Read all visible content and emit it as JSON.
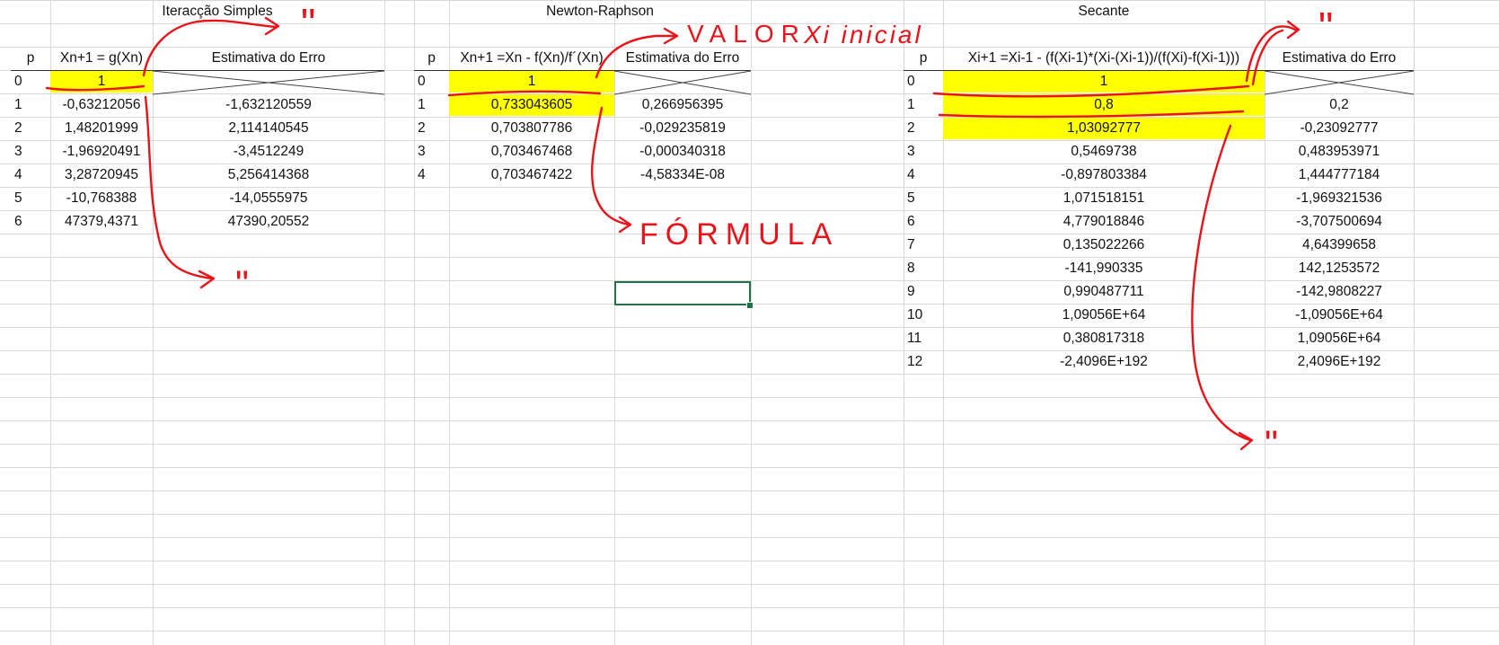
{
  "sections": {
    "iteracao": {
      "title": "Iteracção Simples",
      "headers": {
        "p": "p",
        "x": "Xn+1 = g(Xn)",
        "err": "Estimativa do Erro"
      },
      "rows": [
        {
          "p": "0",
          "x": "1",
          "err": ""
        },
        {
          "p": "1",
          "x": "-0,63212056",
          "err": "-1,632120559"
        },
        {
          "p": "2",
          "x": "1,48201999",
          "err": "2,114140545"
        },
        {
          "p": "3",
          "x": "-1,96920491",
          "err": "-3,4512249"
        },
        {
          "p": "4",
          "x": "3,28720945",
          "err": "5,256414368"
        },
        {
          "p": "5",
          "x": "-10,768388",
          "err": "-14,0555975"
        },
        {
          "p": "6",
          "x": "47379,4371",
          "err": "47390,20552"
        }
      ]
    },
    "newton": {
      "title": "Newton-Raphson",
      "headers": {
        "p": "p",
        "x": "Xn+1 =Xn - f(Xn)/f´(Xn)",
        "err": "Estimativa do Erro"
      },
      "rows": [
        {
          "p": "0",
          "x": "1",
          "err": ""
        },
        {
          "p": "1",
          "x": "0,733043605",
          "err": "0,266956395"
        },
        {
          "p": "2",
          "x": "0,703807786",
          "err": "-0,029235819"
        },
        {
          "p": "3",
          "x": "0,703467468",
          "err": "-0,000340318"
        },
        {
          "p": "4",
          "x": "0,703467422",
          "err": "-4,58334E-08"
        }
      ]
    },
    "secante": {
      "title": "Secante",
      "headers": {
        "p": "p",
        "x": "Xi+1 =Xi-1 - (f(Xi-1)*(Xi-(Xi-1))/(f(Xi)-f(Xi-1)))",
        "err": "Estimativa do Erro"
      },
      "rows": [
        {
          "p": "0",
          "x": "1",
          "err": ""
        },
        {
          "p": "1",
          "x": "0,8",
          "err": "0,2"
        },
        {
          "p": "2",
          "x": "1,03092777",
          "err": "-0,23092777"
        },
        {
          "p": "3",
          "x": "0,5469738",
          "err": "0,483953971"
        },
        {
          "p": "4",
          "x": "-0,897803384",
          "err": "1,444777184"
        },
        {
          "p": "5",
          "x": "1,071518151",
          "err": "-1,969321536"
        },
        {
          "p": "6",
          "x": "4,779018846",
          "err": "-3,707500694"
        },
        {
          "p": "7",
          "x": "0,135022266",
          "err": "4,64399658"
        },
        {
          "p": "8",
          "x": "-141,990335",
          "err": "142,1253572"
        },
        {
          "p": "9",
          "x": "0,990487711",
          "err": "-142,9808227"
        },
        {
          "p": "10",
          "x": "1,09056E+64",
          "err": "-1,09056E+64"
        },
        {
          "p": "11",
          "x": "0,380817318",
          "err": "1,09056E+64"
        },
        {
          "p": "12",
          "x": "-2,4096E+192",
          "err": "2,4096E+192"
        }
      ]
    }
  },
  "annotations": {
    "valor_label": "VALOR",
    "xi_inicial_label": "Xi inicial",
    "formula_label": "FÓRMULA",
    "ditto_mark": "\"",
    "ink_color": "#e8141a",
    "highlight_color": "#ffff00",
    "selection_color": "#217346"
  }
}
